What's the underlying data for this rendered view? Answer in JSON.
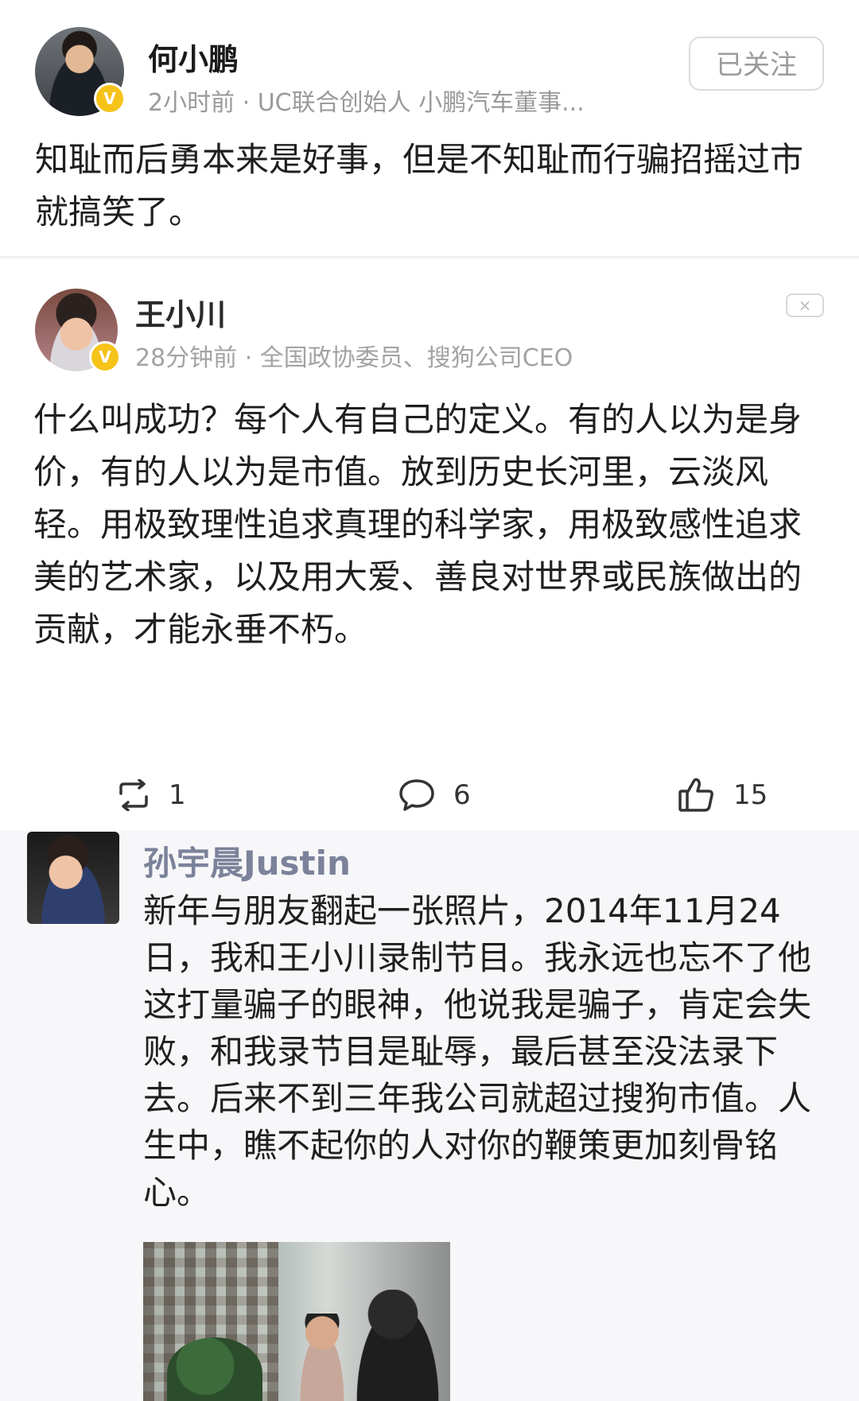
{
  "post": {
    "author": "何小鹏",
    "meta": "2小时前 · UC联合创始人 小鹏汽车董事...",
    "follow_label": "已关注",
    "verified_badge": "V",
    "text": "知耻而后勇本来是好事，但是不知耻而行骗招摇过市就搞笑了。"
  },
  "quoted": {
    "author": "王小川",
    "meta": "28分钟前 · 全国政协委员、搜狗公司CEO",
    "verified_badge": "V",
    "close_label": "×",
    "text": "什么叫成功？每个人有自己的定义。有的人以为是身价，有的人以为是市值。放到历史长河里，云淡风轻。用极致理性追求真理的科学家，用极致感性追求美的艺术家，以及用大爱、善良对世界或民族做出的贡献，才能永垂不朽。",
    "actions": {
      "repost_count": "1",
      "comment_count": "6",
      "like_count": "15"
    }
  },
  "reply": {
    "author": "孙宇晨Justin",
    "text": "新年与朋友翻起一张照片，2014年11月24日，我和王小川录制节目。我永远也忘不了他这打量骗子的眼神，他说我是骗子，肯定会失败，和我录节目是耻辱，最后甚至没法录下去。后来不到三年我公司就超过搜狗市值。人生中，瞧不起你的人对你的鞭策更加刻骨铭心。"
  },
  "colors": {
    "verified_badge": "#f6c319",
    "reply_author": "#7b829a",
    "meta_text": "#9a9a9a",
    "reply_background": "#f7f7f9"
  },
  "icons": {
    "repost": "repost-icon",
    "comment": "comment-icon",
    "like": "thumbs-up-icon",
    "close": "close-icon"
  }
}
